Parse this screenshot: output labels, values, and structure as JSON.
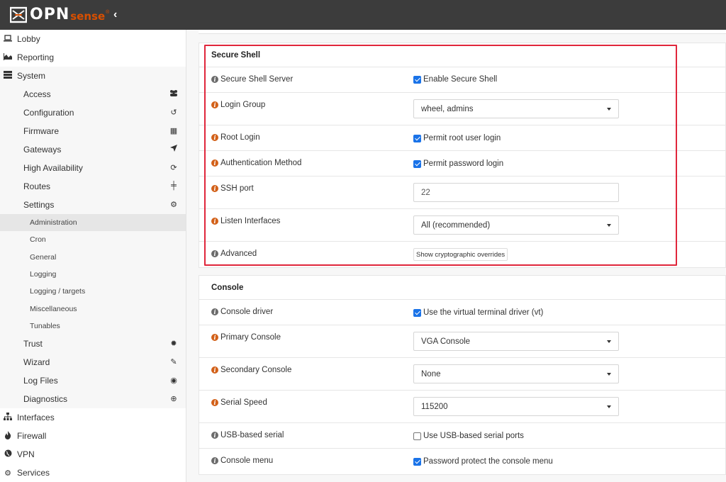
{
  "brand": {
    "name_main": "OPN",
    "name_sub": "sense",
    "reg": "®"
  },
  "sidebar": {
    "top_items": [
      {
        "label": "Lobby",
        "icon": "laptop-icon"
      },
      {
        "label": "Reporting",
        "icon": "area-chart-icon"
      },
      {
        "label": "System",
        "icon": "server-icon"
      }
    ],
    "system_items": [
      {
        "label": "Access",
        "icon": "users-icon",
        "glyph": "👥"
      },
      {
        "label": "Configuration",
        "icon": "history-icon",
        "glyph": "↺"
      },
      {
        "label": "Firmware",
        "icon": "building-icon",
        "glyph": "▦"
      },
      {
        "label": "Gateways",
        "icon": "location-arrow-icon",
        "glyph": "➤"
      },
      {
        "label": "High Availability",
        "icon": "refresh-icon",
        "glyph": "⟳"
      },
      {
        "label": "Routes",
        "icon": "map-signs-icon",
        "glyph": "╪"
      },
      {
        "label": "Settings",
        "icon": "cogs-icon",
        "glyph": "⚙"
      }
    ],
    "settings_items": [
      "Administration",
      "Cron",
      "General",
      "Logging",
      "Logging / targets",
      "Miscellaneous",
      "Tunables"
    ],
    "system_items_after": [
      {
        "label": "Trust",
        "icon": "certificate-icon",
        "glyph": "✹"
      },
      {
        "label": "Wizard",
        "icon": "magic-icon",
        "glyph": "✎"
      },
      {
        "label": "Log Files",
        "icon": "eye-icon",
        "glyph": "◉"
      },
      {
        "label": "Diagnostics",
        "icon": "medkit-icon",
        "glyph": "⊕"
      }
    ],
    "bottom_items": [
      {
        "label": "Interfaces",
        "icon": "sitemap-icon",
        "glyph": "⊞"
      },
      {
        "label": "Firewall",
        "icon": "fire-icon",
        "glyph": "♨"
      },
      {
        "label": "VPN",
        "icon": "globe-icon",
        "glyph": "◍"
      },
      {
        "label": "Services",
        "icon": "cog-icon",
        "glyph": "⚙"
      }
    ]
  },
  "secure_shell": {
    "title": "Secure Shell",
    "server_label": "Secure Shell Server",
    "server_check": "Enable Secure Shell",
    "login_group_label": "Login Group",
    "login_group_value": "wheel, admins",
    "root_login_label": "Root Login",
    "root_login_check": "Permit root user login",
    "auth_label": "Authentication Method",
    "auth_check": "Permit password login",
    "port_label": "SSH port",
    "port_value": "22",
    "listen_label": "Listen Interfaces",
    "listen_value": "All (recommended)",
    "advanced_label": "Advanced",
    "advanced_button": "Show cryptographic overrides"
  },
  "console": {
    "title": "Console",
    "driver_label": "Console driver",
    "driver_check": "Use the virtual terminal driver (vt)",
    "primary_label": "Primary Console",
    "primary_value": "VGA Console",
    "secondary_label": "Secondary Console",
    "secondary_value": "None",
    "serial_speed_label": "Serial Speed",
    "serial_speed_value": "115200",
    "usb_label": "USB-based serial",
    "usb_check": "Use USB-based serial ports",
    "menu_label": "Console menu",
    "menu_check": "Password protect the console menu"
  },
  "colors": {
    "brand_orange": "#d94f00",
    "highlight_red": "#e0263b",
    "checkbox_blue": "#1a73e8",
    "topbar": "#3c3c3c"
  }
}
